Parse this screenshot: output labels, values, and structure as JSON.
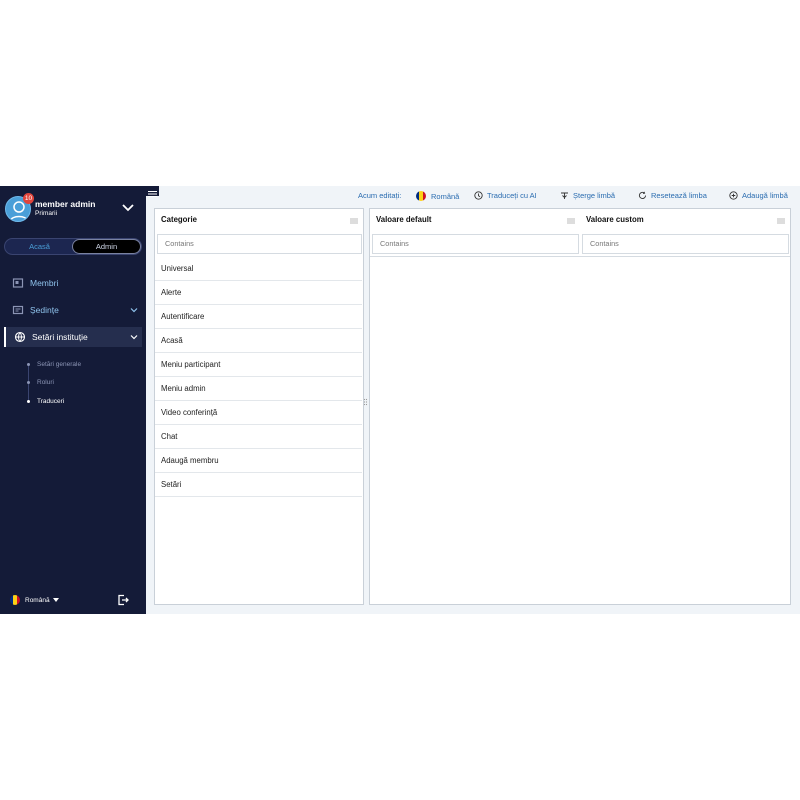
{
  "user": {
    "name": "member admin",
    "role": "Primarii",
    "notifications": "10"
  },
  "mode_toggle": {
    "left": "Acasă",
    "right": "Admin"
  },
  "nav": {
    "membri": "Membri",
    "sedinte": "Ședințe",
    "setari": "Setări instituție",
    "sub": [
      "Setări generale",
      "Roluri",
      "Traduceri"
    ]
  },
  "sidebar_language": "Română",
  "toolbar": {
    "editing_label": "Acum editați:",
    "language": "Română",
    "translate_ai": "Traduceți cu AI",
    "delete_lang": "Șterge limbă",
    "reset_lang": "Resetează limba",
    "add_lang": "Adaugă limbă"
  },
  "left_table": {
    "header": "Categorie",
    "filter_placeholder": "Contains",
    "rows": [
      "Universal",
      "Alerte",
      "Autentificare",
      "Acasă",
      "Meniu participant",
      "Meniu admin",
      "Video conferință",
      "Chat",
      "Adaugă membru",
      "Setări"
    ]
  },
  "right_table": {
    "col1_header": "Valoare default",
    "col2_header": "Valoare custom",
    "col1_filter": "Contains",
    "col2_filter": "Contains"
  },
  "colors": {
    "sidebar_bg": "#141b38",
    "accent": "#2a6cb0",
    "badge": "#e0453c"
  },
  "icons": [
    "user-avatar-icon",
    "chevron-down-icon",
    "members-icon",
    "meetings-icon",
    "globe-icon",
    "logout-icon",
    "hamburger-icon",
    "translate-icon",
    "delete-icon",
    "reset-icon",
    "add-icon",
    "column-menu-icon"
  ]
}
